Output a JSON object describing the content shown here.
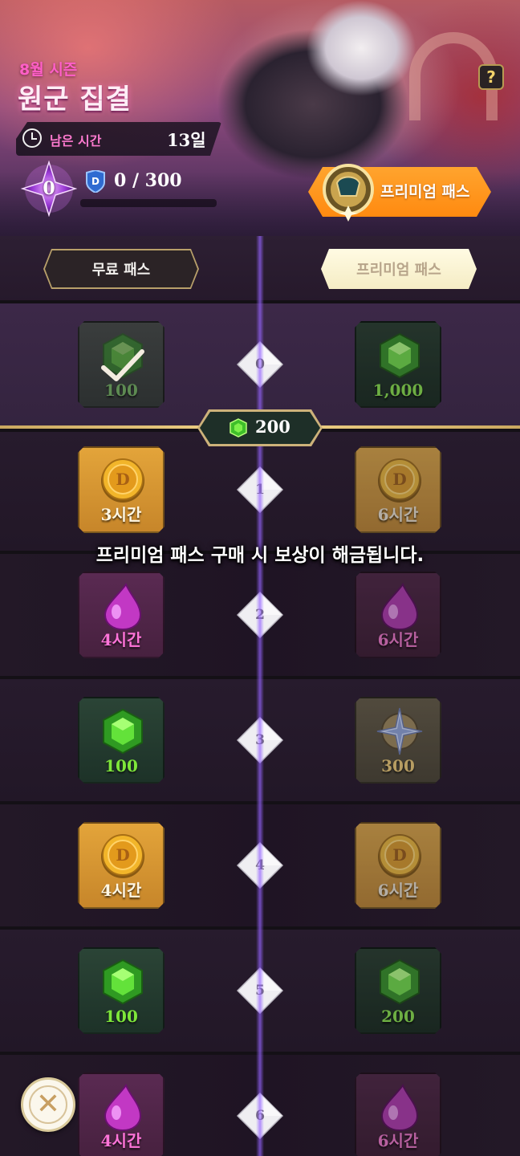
{
  "season": {
    "label": "8월 시즌",
    "title": "원군 집결",
    "remaining_label": "남은 시간",
    "remaining_value": "13일",
    "level": "0",
    "xp_text": "0 / 300",
    "xp_progress": 0
  },
  "header": {
    "help_label": "?",
    "premium_button_label": "프리미엄 패스"
  },
  "tabs": {
    "free": "무료 패스",
    "premium": "프리미엄 패스"
  },
  "milestone": {
    "icon": "green-gem-icon",
    "value": "200"
  },
  "unlock_notice": "프리미엄 패스 구매 시 보상이 해금됩니다.",
  "rewards": [
    {
      "level": "0",
      "free": {
        "icon": "green-gem-icon",
        "qty": "100",
        "claimed": true
      },
      "premium": {
        "icon": "green-gem-icon",
        "qty": "1,000"
      }
    },
    {
      "level": "1",
      "free": {
        "icon": "gold-coin-icon",
        "qty": "3시간"
      },
      "premium": {
        "icon": "gold-coin-icon",
        "qty": "6시간"
      }
    },
    {
      "level": "2",
      "free": {
        "icon": "purple-drop-icon",
        "qty": "4시간"
      },
      "premium": {
        "icon": "purple-drop-icon",
        "qty": "6시간"
      }
    },
    {
      "level": "3",
      "free": {
        "icon": "green-gem-icon",
        "qty": "100"
      },
      "premium": {
        "icon": "compass-star-icon",
        "qty": "300"
      }
    },
    {
      "level": "4",
      "free": {
        "icon": "gold-coin-icon",
        "qty": "4시간"
      },
      "premium": {
        "icon": "gold-coin-icon",
        "qty": "6시간"
      }
    },
    {
      "level": "5",
      "free": {
        "icon": "green-gem-icon",
        "qty": "100"
      },
      "premium": {
        "icon": "green-gem-icon",
        "qty": "200"
      }
    },
    {
      "level": "6",
      "free": {
        "icon": "purple-drop-icon",
        "qty": "4시간"
      },
      "premium": {
        "icon": "purple-drop-icon",
        "qty": "6시간"
      }
    }
  ],
  "close_label": "✕",
  "colors": {
    "accent_gold": "#e7c35a",
    "premium_orange": "#ff8a10",
    "gem_green": "#7ee63a",
    "drop_pink": "#ff74d9",
    "season_pink": "#ff5fc8"
  }
}
